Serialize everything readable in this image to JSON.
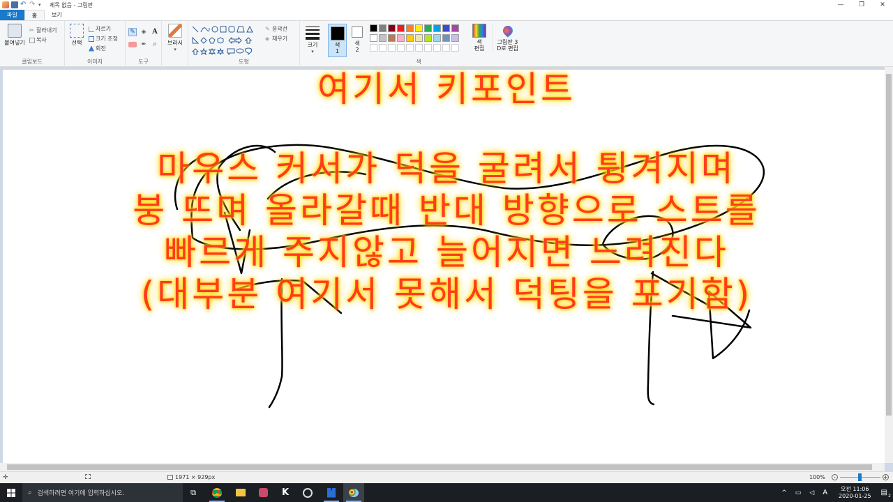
{
  "window": {
    "title": "제목 없음 - 그림판",
    "controls": [
      "—",
      "❐",
      "✕"
    ]
  },
  "tabs": [
    {
      "label": "파일"
    },
    {
      "label": "홈"
    },
    {
      "label": "보기"
    }
  ],
  "ribbon": {
    "clipboard": {
      "group_label": "클립보드",
      "paste": "붙여넣기",
      "cut": "잘라내기",
      "copy": "복사"
    },
    "image": {
      "group_label": "이미지",
      "select": "선택",
      "crop": "자르기",
      "resize": "크기 조정",
      "rotate": "회전"
    },
    "tools": {
      "group_label": "도구"
    },
    "brushes": {
      "label": "브러시"
    },
    "shapes": {
      "group_label": "도형",
      "outline": "윤곽선",
      "fill": "채우기"
    },
    "size": {
      "label": "크기"
    },
    "color1": {
      "label": "색\n1"
    },
    "color2": {
      "label": "색\n2"
    },
    "colors": {
      "group_label": "색",
      "row1": [
        "#000000",
        "#7f7f7f",
        "#880015",
        "#ed1c24",
        "#ff7f27",
        "#fff200",
        "#22b14c",
        "#00a2e8",
        "#3f48cc",
        "#a349a4"
      ],
      "row2": [
        "#ffffff",
        "#c3c3c3",
        "#b97a57",
        "#ffaec9",
        "#ffc90e",
        "#efe4b0",
        "#b5e61d",
        "#99d9ea",
        "#7092be",
        "#c8bfe7"
      ],
      "row3": [
        "#ffffff",
        "#ffffff",
        "#ffffff",
        "#ffffff",
        "#ffffff",
        "#ffffff",
        "#ffffff",
        "#ffffff",
        "#ffffff",
        "#ffffff"
      ],
      "primary": "#000000",
      "secondary": "#ffffff"
    },
    "edit_colors": {
      "label": "색\n편집"
    },
    "paint3d": {
      "label": "그림판 3\nD로 편집"
    }
  },
  "overlay": {
    "line1": "여기서 키포인트",
    "line2": "마우스 커서가 덕을 굴려서 튕겨지며",
    "line3": "붕 뜨며 올라갈때 반대 방향으로 스트를",
    "line4": "빠르게 주지않고 늘어지면 느려진다",
    "line5": "(대부분 여기서 못해서 덕팅을 포기함)"
  },
  "statusbar": {
    "dimensions": "1971 × 929px",
    "zoom": "100%"
  },
  "taskbar": {
    "search_placeholder": "검색하려면 여기에 입력하십시오.",
    "time": "오전 11:06",
    "date": "2020-01-25",
    "notification_count": "2"
  }
}
